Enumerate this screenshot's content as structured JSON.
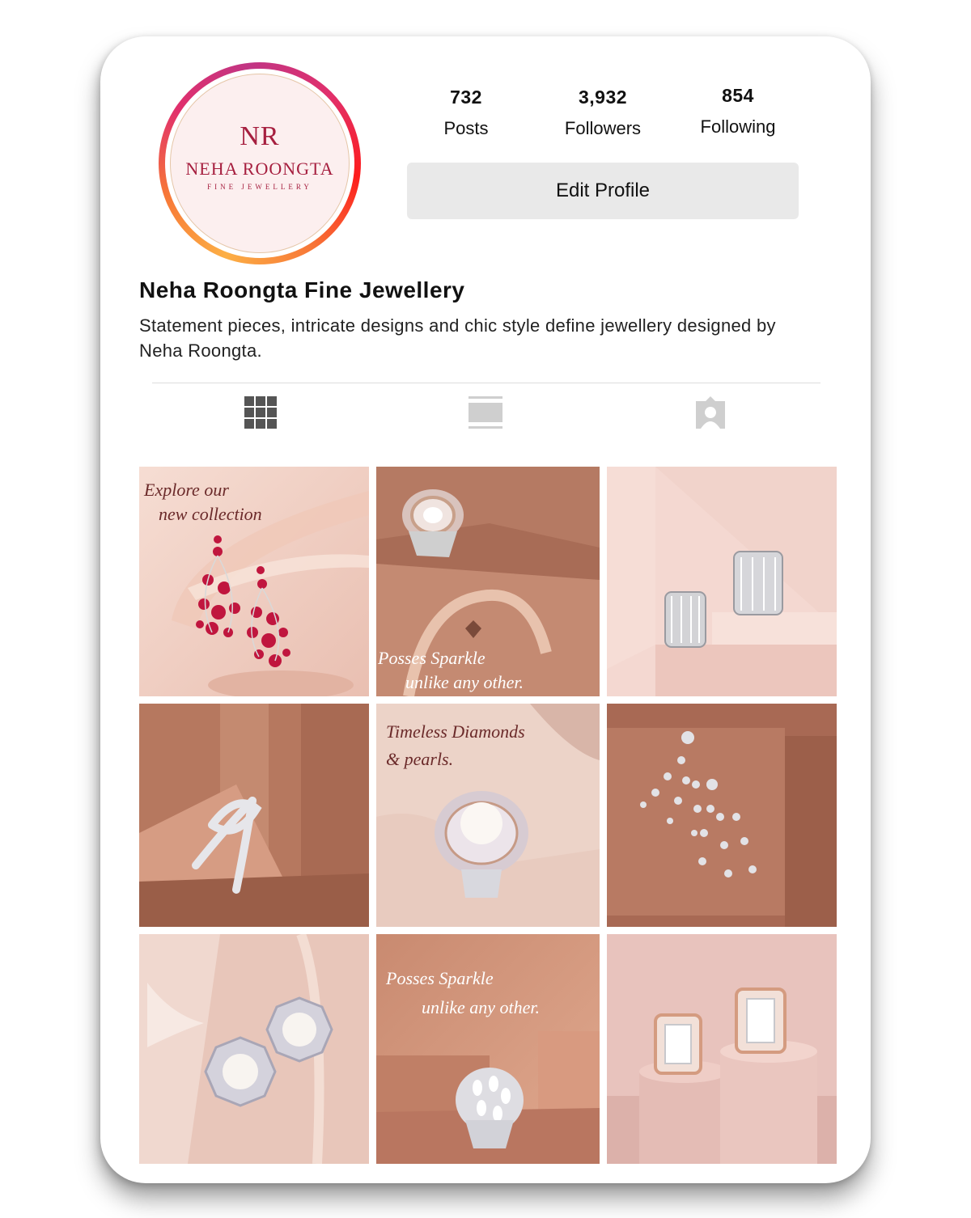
{
  "profile": {
    "avatar": {
      "monogram": "NR",
      "brand": "NEHA ROONGTA",
      "tagline": "FINE JEWELLERY"
    },
    "stats": [
      {
        "value": "732",
        "label": "Posts"
      },
      {
        "value": "3,932",
        "label": "Followers"
      },
      {
        "value": "854",
        "label": "Following"
      }
    ],
    "edit_button": "Edit Profile",
    "name": "Neha Roongta Fine Jewellery",
    "bio": "Statement pieces, intricate designs and chic style define jewellery designed by Neha Roongta."
  },
  "tabs": [
    {
      "icon": "grid-icon",
      "active": true
    },
    {
      "icon": "feed-icon",
      "active": false
    },
    {
      "icon": "tagged-icon",
      "active": false
    }
  ],
  "posts": [
    {
      "overlay_lines": [
        "Explore our",
        "new collection"
      ],
      "subject": "ruby drop earrings"
    },
    {
      "overlay_lines": [
        "Posses Sparkle",
        "unlike any other."
      ],
      "subject": "diamond cocktail ring"
    },
    {
      "overlay_lines": [],
      "subject": "baguette diamond earrings"
    },
    {
      "overlay_lines": [],
      "subject": "diamond bow ring"
    },
    {
      "overlay_lines": [
        "Timeless Diamonds",
        "& pearls."
      ],
      "subject": "pearl diamond ring"
    },
    {
      "overlay_lines": [],
      "subject": "diamond cascade earrings"
    },
    {
      "overlay_lines": [],
      "subject": "pearl octagon studs"
    },
    {
      "overlay_lines": [
        "Posses Sparkle",
        "unlike any other."
      ],
      "subject": "marquise diamond ring"
    },
    {
      "overlay_lines": [],
      "subject": "emerald-cut diamond studs"
    }
  ],
  "colors": {
    "brand": "#a61f3f",
    "rose_light": "#f3d5cb",
    "copper": "#b9785f",
    "pink_light": "#f1d6d0"
  }
}
